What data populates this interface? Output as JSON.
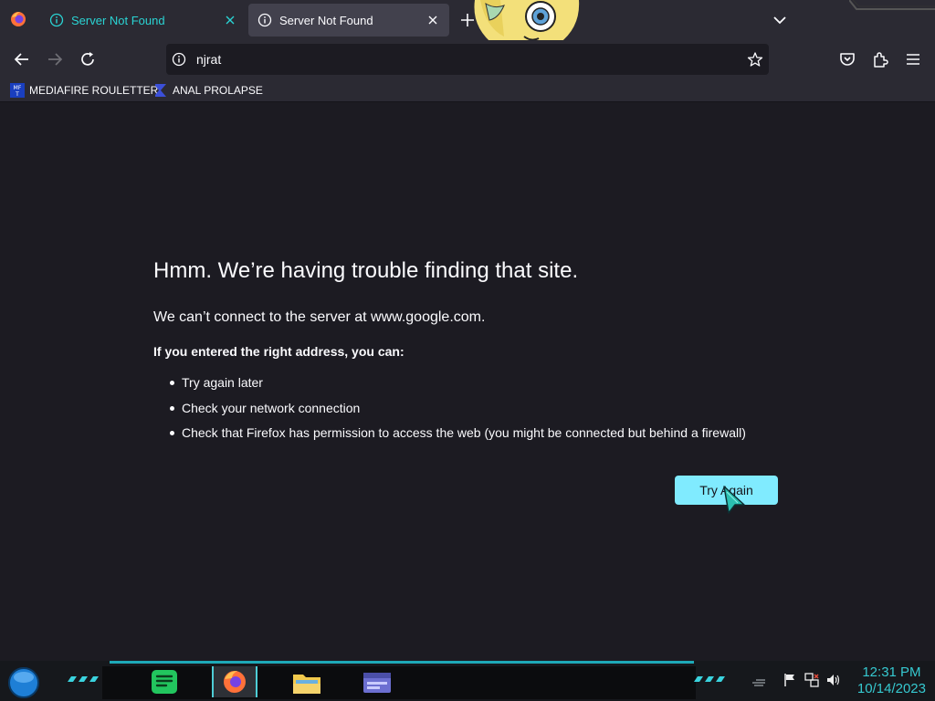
{
  "browser": {
    "tabs": [
      {
        "title": "Server Not Found",
        "active": false
      },
      {
        "title": "Server Not Found",
        "active": true
      }
    ],
    "url": "njrat",
    "bookmarks": [
      {
        "label": "MEDIAFIRE ROULETTER",
        "favicon_text": "MF T"
      },
      {
        "label": "ANAL PROLAPSE"
      }
    ],
    "accent_color": "#2ad4d4"
  },
  "error_page": {
    "title": "Hmm. We’re having trouble finding that site.",
    "short_desc": "We can’t connect to the server at www.google.com.",
    "hint": "If you entered the right address, you can:",
    "suggestions": [
      "Try again later",
      "Check your network connection",
      "Check that Firefox has permission to access the web (you might be connected but behind a firewall)"
    ],
    "button_label": "Try Again",
    "button_color": "#80ebff"
  },
  "taskbar": {
    "apps": [
      "spotify-icon",
      "firefox-icon",
      "file-explorer-icon",
      "window-app-icon"
    ],
    "clock": {
      "time": "12:31 PM",
      "date": "10/14/2023"
    },
    "clock_color": "#36c9d0"
  }
}
